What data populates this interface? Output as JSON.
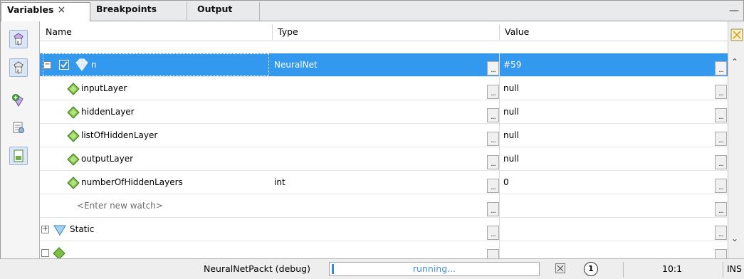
{
  "tabs": [
    {
      "label": "Variables",
      "close": "×"
    },
    {
      "label": "Breakpoints"
    },
    {
      "label": "Output"
    }
  ],
  "minimize_glyph": "—",
  "columns": {
    "name": "Name",
    "type": "Type",
    "value": "Value"
  },
  "rows": [
    {
      "name": "n",
      "type": "NeuralNet",
      "value": "#59",
      "selected": true,
      "expand": "−"
    },
    {
      "name": "inputLayer",
      "type": "",
      "value": "null"
    },
    {
      "name": "hiddenLayer",
      "type": "",
      "value": "null"
    },
    {
      "name": "listOfHiddenLayer",
      "type": "",
      "value": "null"
    },
    {
      "name": "outputLayer",
      "type": "",
      "value": "null"
    },
    {
      "name": "numberOfHiddenLayers",
      "type": "int",
      "value": "0"
    },
    {
      "name": "<Enter new watch>",
      "type": "",
      "value": ""
    },
    {
      "name": "Static",
      "type": "",
      "value": "",
      "expand": "+"
    }
  ],
  "ellipsis": "...",
  "status": {
    "session": "NeuralNetPackt (debug)",
    "progress_text": "running...",
    "notifications": "1",
    "position": "10:1",
    "mode": "INS"
  },
  "icons": {
    "toolbar": [
      "watch-icon",
      "watch-pressed-icon",
      "add-watch-icon",
      "settings-icon",
      "document-icon"
    ],
    "field": "field-diamond-icon",
    "object": "object-icon",
    "static": "static-icon"
  }
}
